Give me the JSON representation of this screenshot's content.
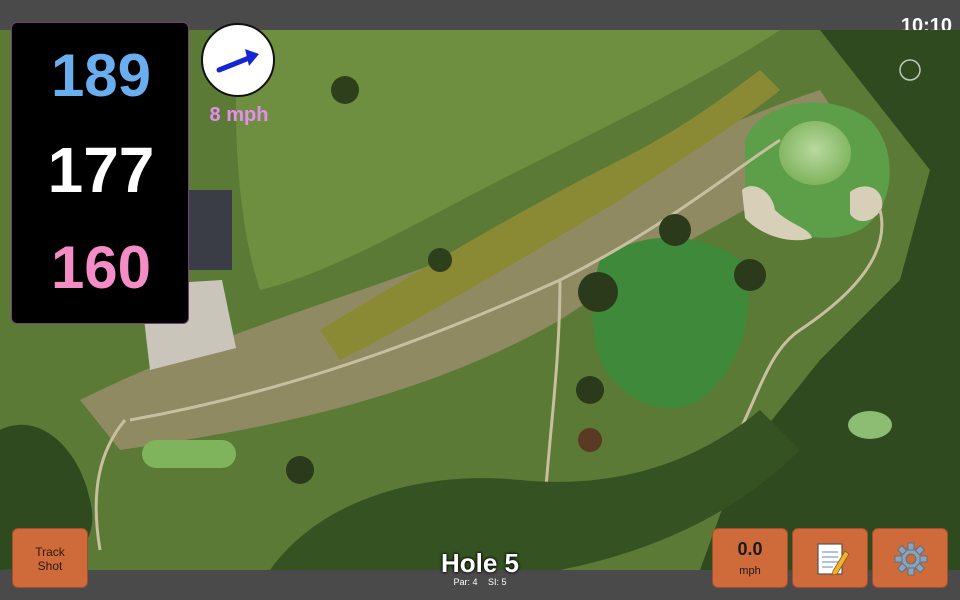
{
  "status_bar": {
    "time": "10:10"
  },
  "distances": {
    "back": "189",
    "middle": "177",
    "front": "160"
  },
  "wind": {
    "speed_label": "8 mph",
    "direction_icon": "arrow-right-icon"
  },
  "hole": {
    "title": "Hole 5",
    "par_label": "Par: 4",
    "si_label": "SI: 5"
  },
  "buttons": {
    "track_shot_line1": "Track",
    "track_shot_line2": "Shot",
    "wind_value": "0.0",
    "wind_unit": "mph",
    "notes_icon": "notepad-icon",
    "settings_icon": "gear-icon"
  },
  "colors": {
    "back_distance": "#6aaef0",
    "middle_distance": "#ffffff",
    "front_distance": "#f48cc5",
    "wind_label": "#e58df0",
    "button": "#cf6b3a",
    "bar": "#4a4a4a"
  }
}
